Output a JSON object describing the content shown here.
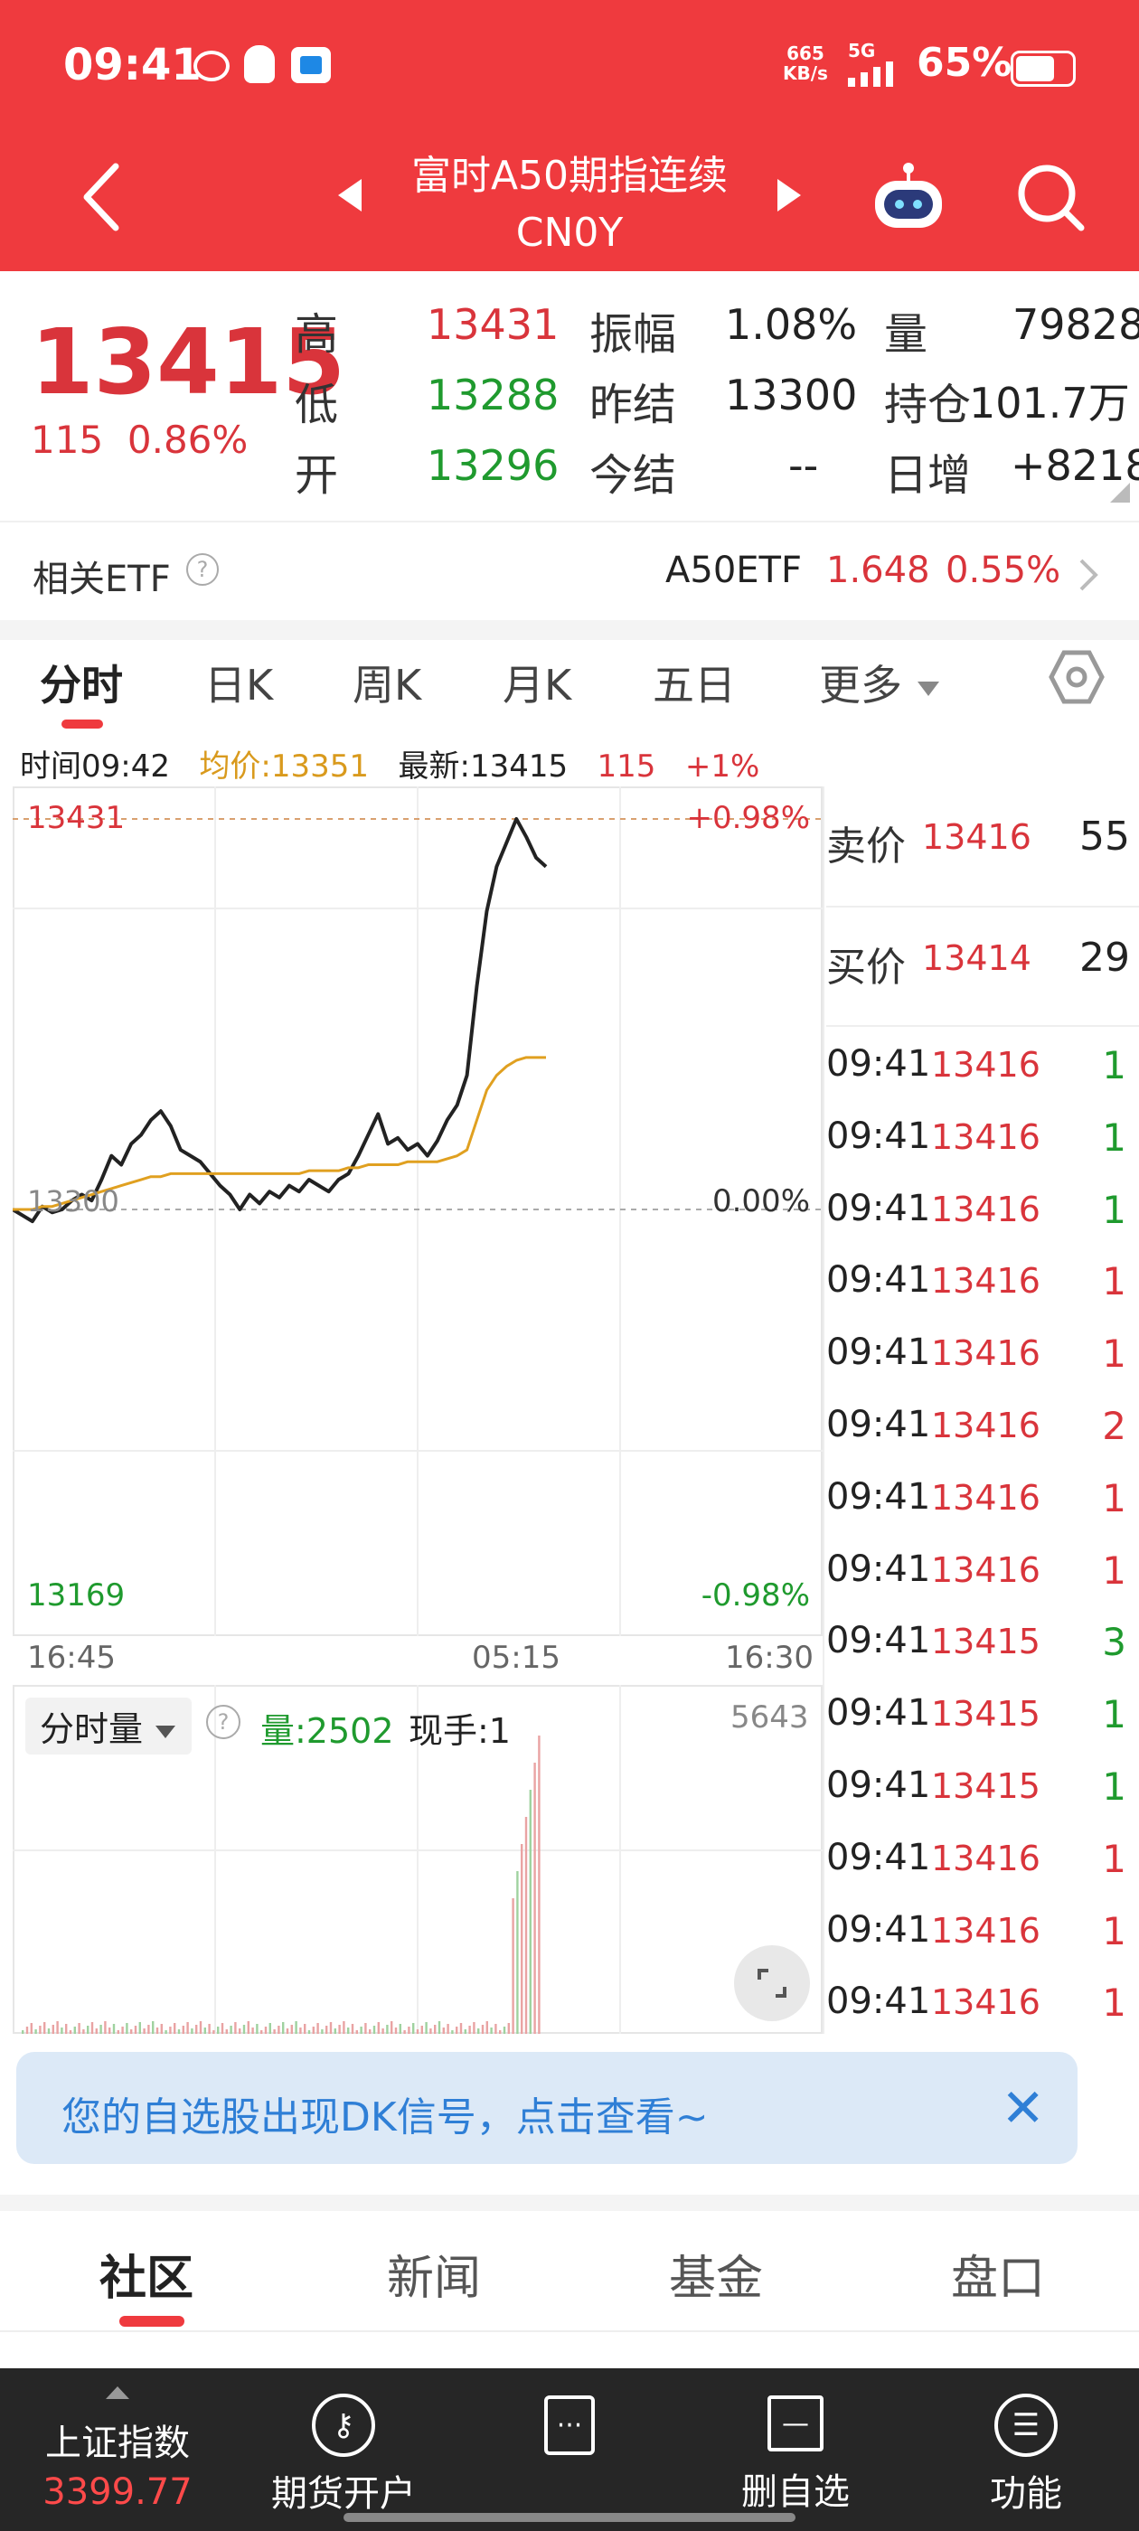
{
  "status_bar": {
    "time": "09:41",
    "net_speed": "665",
    "net_unit": "KB/s",
    "signal": "5G",
    "battery": "65%"
  },
  "header": {
    "title": "富时A50期指连续",
    "code": "CN0Y"
  },
  "quote": {
    "price": "13415",
    "change": "115",
    "change_pct": "0.86%",
    "stats": [
      {
        "label": "高",
        "value": "13431",
        "color": "red",
        "label2": "振幅",
        "value2": "1.08%",
        "label3": "量",
        "value3": "79828"
      },
      {
        "label": "低",
        "value": "13288",
        "color": "green",
        "label2": "昨结",
        "value2": "13300",
        "label3": "持仓",
        "value3": "101.7万"
      },
      {
        "label": "开",
        "value": "13296",
        "color": "green",
        "label2": "今结",
        "value2": "--",
        "label3": "日增",
        "value3": "+8218"
      }
    ]
  },
  "related_etf": {
    "label": "相关ETF",
    "help": "?",
    "name": "A50ETF",
    "price": "1.648",
    "pct": "0.55%"
  },
  "tabs": [
    "分时",
    "日K",
    "周K",
    "月K",
    "五日",
    "更多"
  ],
  "info_line": {
    "time_label": "时间09:42",
    "avg_label": "均价:13351",
    "latest_label": "最新:13415",
    "change": "115",
    "pct": "+1%"
  },
  "chart": {
    "high_label": "13431",
    "high_pct": "+0.98%",
    "base_label": "13300",
    "base_pct": "0.00%",
    "low_label": "13169",
    "low_pct": "-0.98%",
    "time_ticks": [
      "16:45",
      "05:15",
      "16:30"
    ],
    "volume_selector": "分时量",
    "volume_label": "量:2502",
    "current_hand": "现手:1",
    "volume_max": "5643"
  },
  "chart_data": {
    "type": "line",
    "title": "",
    "ylim": [
      13169,
      13431
    ],
    "series": [
      {
        "values": [
          13300,
          13298,
          13296,
          13301,
          13299,
          13300,
          13303,
          13305,
          13303,
          13310,
          13318,
          13315,
          13322,
          13325,
          13330,
          13333,
          13328,
          13320,
          13318,
          13316,
          13312,
          13308,
          13305,
          13300,
          13305,
          13302,
          13306,
          13304,
          13308,
          13306,
          13310,
          13308,
          13306,
          13310,
          13312,
          13318,
          13325,
          13332,
          13322,
          13324,
          13320,
          13322,
          13318,
          13323,
          13330,
          13335,
          13345,
          13375,
          13400,
          13415,
          13423,
          13431,
          13425,
          13418,
          13415
        ]
      },
      {
        "values": [
          13300,
          13300,
          13300,
          13301,
          13301,
          13302,
          13303,
          13304,
          13305,
          13306,
          13307,
          13308,
          13309,
          13310,
          13311,
          13311,
          13312,
          13312,
          13312,
          13312,
          13312,
          13312,
          13312,
          13312,
          13312,
          13312,
          13312,
          13312,
          13312,
          13312,
          13313,
          13313,
          13313,
          13313,
          13314,
          13314,
          13315,
          13315,
          13315,
          13315,
          13316,
          13316,
          13316,
          13316,
          13317,
          13318,
          13320,
          13330,
          13340,
          13345,
          13348,
          13350,
          13351,
          13351,
          13351
        ]
      }
    ]
  },
  "order_book": {
    "ask_label": "卖价",
    "ask_price": "13416",
    "ask_volume": "55",
    "bid_label": "买价",
    "bid_price": "13414",
    "bid_volume": "29"
  },
  "trades": [
    {
      "time": "09:41",
      "price": "13416",
      "volume": "1",
      "color": "green"
    },
    {
      "time": "09:41",
      "price": "13416",
      "volume": "1",
      "color": "green"
    },
    {
      "time": "09:41",
      "price": "13416",
      "volume": "1",
      "color": "green"
    },
    {
      "time": "09:41",
      "price": "13416",
      "volume": "1",
      "color": "red"
    },
    {
      "time": "09:41",
      "price": "13416",
      "volume": "1",
      "color": "red"
    },
    {
      "time": "09:41",
      "price": "13416",
      "volume": "2",
      "color": "red"
    },
    {
      "time": "09:41",
      "price": "13416",
      "volume": "1",
      "color": "red"
    },
    {
      "time": "09:41",
      "price": "13416",
      "volume": "1",
      "color": "red"
    },
    {
      "time": "09:41",
      "price": "13415",
      "volume": "3",
      "color": "green"
    },
    {
      "time": "09:41",
      "price": "13415",
      "volume": "1",
      "color": "green"
    },
    {
      "time": "09:41",
      "price": "13415",
      "volume": "1",
      "color": "green"
    },
    {
      "time": "09:41",
      "price": "13416",
      "volume": "1",
      "color": "red"
    },
    {
      "time": "09:41",
      "price": "13416",
      "volume": "1",
      "color": "red"
    },
    {
      "time": "09:41",
      "price": "13416",
      "volume": "1",
      "color": "red"
    }
  ],
  "banner": {
    "text": "您的自选股出现DK信号，点击查看~",
    "close": "✕"
  },
  "bottom_tabs": [
    "社区",
    "新闻",
    "基金",
    "盘口"
  ],
  "bottom_bar": {
    "index_name": "上证指数",
    "index_value": "3399.77",
    "items": [
      "期货开户",
      "删自选",
      "功能"
    ]
  }
}
